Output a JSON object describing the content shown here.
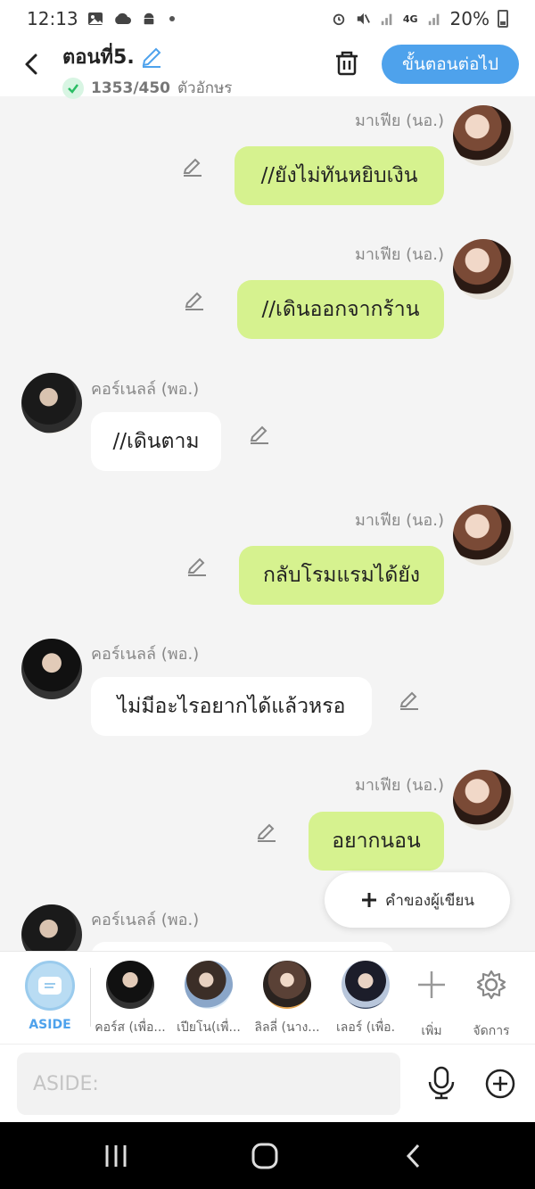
{
  "status_bar": {
    "time": "12:13",
    "battery": "20%",
    "network": "4G"
  },
  "header": {
    "title": "ตอนที่5.",
    "char_count": "1353/450",
    "char_unit": "ตัวอักษร",
    "next_button": "ขั้นตอนต่อไป"
  },
  "messages": [
    {
      "speaker": "มาเฟีย (นอ.)",
      "text": "//ยังไม่ทันหยิบเงิน",
      "side": "right"
    },
    {
      "speaker": "มาเฟีย (นอ.)",
      "text": "//เดินออกจากร้าน",
      "side": "right"
    },
    {
      "speaker": "คอร์เนลล์ (พอ.)",
      "text": "//เดินตาม",
      "side": "left"
    },
    {
      "speaker": "มาเฟีย (นอ.)",
      "text": "กลับโรมแรมได้ยัง",
      "side": "right"
    },
    {
      "speaker": "คอร์เนลล์ (พอ.)",
      "text": "ไม่มีอะไรอยากได้แล้วหรอ",
      "side": "left"
    },
    {
      "speaker": "มาเฟีย (นอ.)",
      "text": "อยากนอน",
      "side": "right"
    },
    {
      "speaker": "คอร์เนลล์ (พอ.)",
      "text": "",
      "side": "left"
    }
  ],
  "fab_label": "คำของผู้เขียน",
  "characters": {
    "aside": "ASIDE",
    "items": [
      "คอร์ส (เพื่อ...",
      "เปียโน(เพื่...",
      "ลิลลี่ (นาง...",
      "เลอร์ (เพื่อ."
    ],
    "add": "เพิ่ม",
    "manage": "จัดการ"
  },
  "input": {
    "placeholder": "ASIDE:"
  },
  "colors": {
    "accent": "#4ea2ec",
    "bubble_green": "#d6f28f"
  }
}
